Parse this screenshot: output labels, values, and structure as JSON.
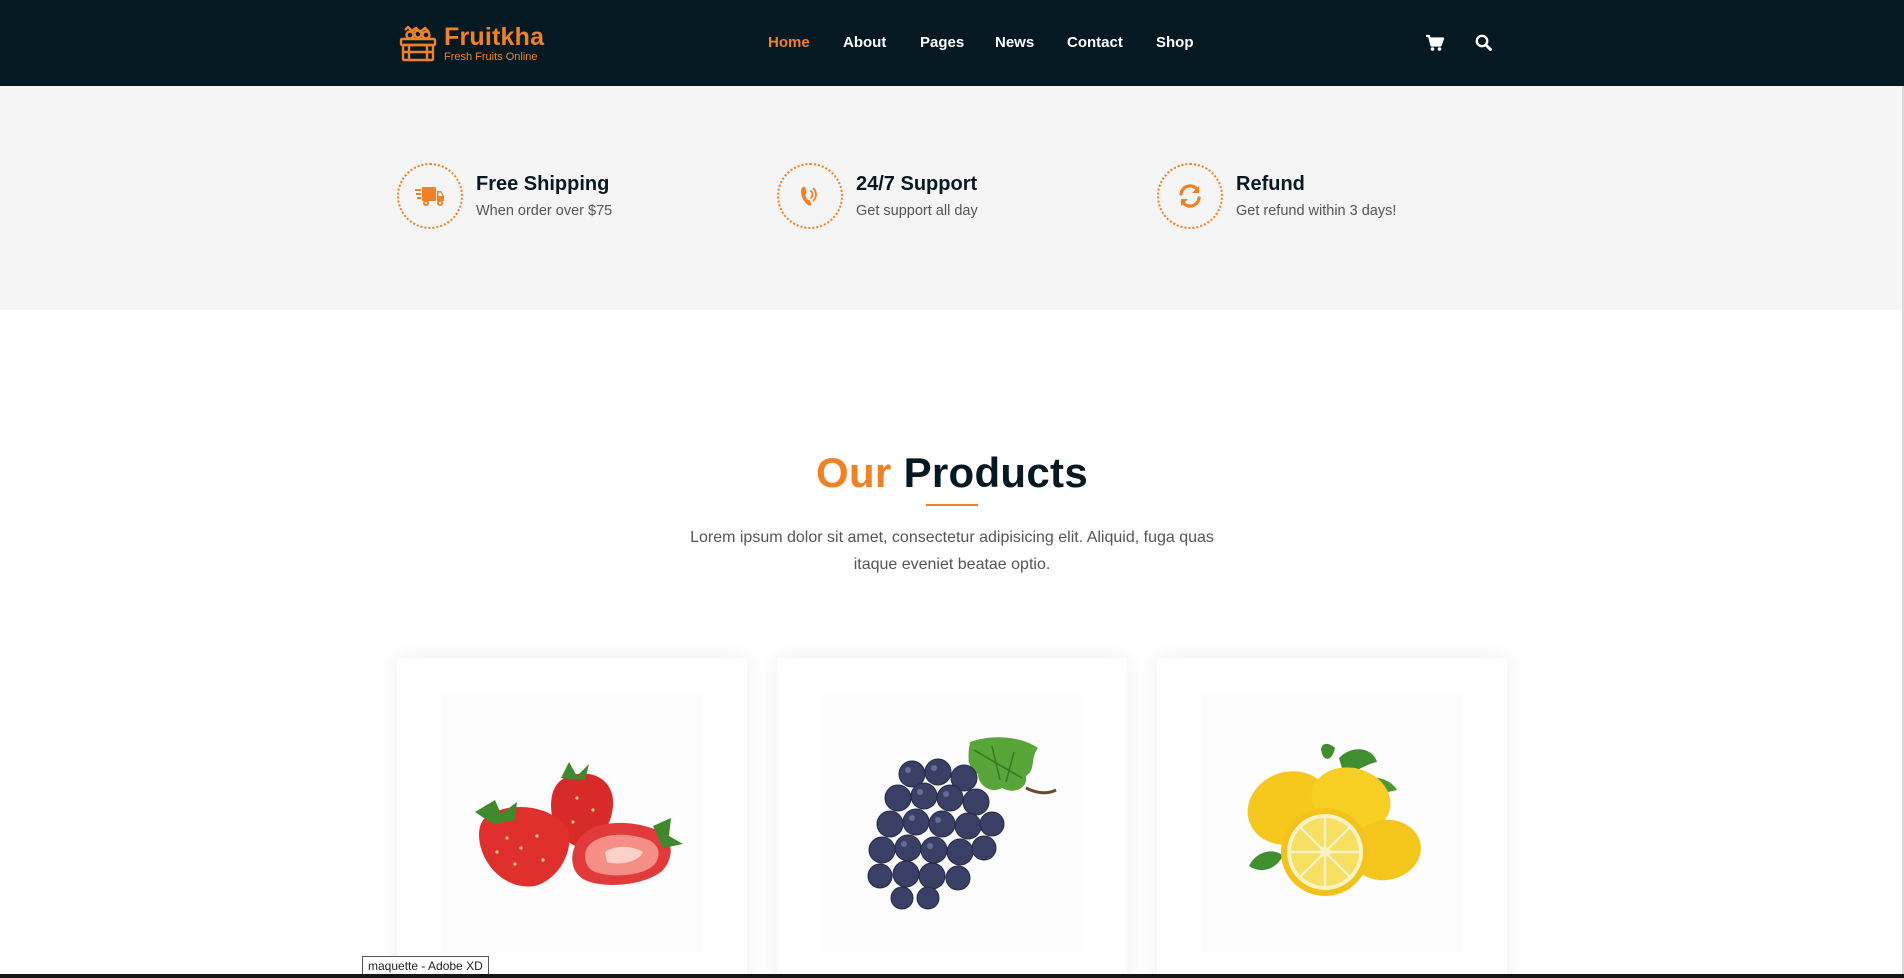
{
  "brand": {
    "name": "Fruitkha",
    "tagline": "Fresh Fruits Online",
    "accent_color": "#F28123",
    "dark_color": "#051922"
  },
  "nav": {
    "items": [
      {
        "label": "Home",
        "active": true
      },
      {
        "label": "About",
        "active": false
      },
      {
        "label": "Pages",
        "active": false
      },
      {
        "label": "News",
        "active": false
      },
      {
        "label": "Contact",
        "active": false
      },
      {
        "label": "Shop",
        "active": false
      }
    ],
    "icons": [
      "shopping-cart-icon",
      "search-icon"
    ]
  },
  "features": [
    {
      "icon": "delivery-truck-icon",
      "title": "Free Shipping",
      "subtitle": "When order over $75"
    },
    {
      "icon": "phone-volume-icon",
      "title": "24/7 Support",
      "subtitle": "Get support all day"
    },
    {
      "icon": "refresh-icon",
      "title": "Refund",
      "subtitle": "Get refund within 3 days!"
    }
  ],
  "products_section": {
    "title_highlight": "Our",
    "title_rest": "Products",
    "description": "Lorem ipsum dolor sit amet, consectetur adipisicing elit. Aliquid, fuga quas itaque eveniet beatae optio."
  },
  "products": [
    {
      "image": "strawberry-image"
    },
    {
      "image": "grapes-image"
    },
    {
      "image": "lemon-image"
    }
  ],
  "tooltip": "maquette - Adobe XD"
}
